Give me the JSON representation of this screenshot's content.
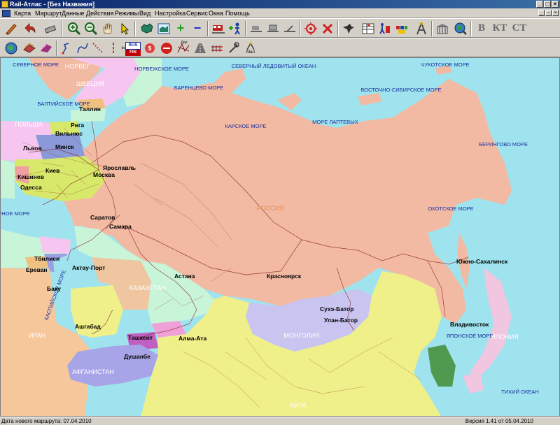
{
  "window": {
    "title": "Rail-Атлас - [Без Названия]",
    "controls": [
      "_",
      "□",
      "×"
    ]
  },
  "menu": [
    "Карта",
    "Маршрут",
    "Данные",
    "Действия",
    "Режимы",
    "Вид",
    "Настройка",
    "Сервис",
    "Окна",
    "Помощь"
  ],
  "toolbar": {
    "letters": [
      "В",
      "КТ",
      "СТ"
    ],
    "rusfin": [
      "RUS",
      "FIN"
    ],
    "small_labels": [
      "boundary",
      "Дор",
      "Мал"
    ]
  },
  "map": {
    "colors": {
      "sea": "#9fe3ee",
      "russia": "#f2b9a3",
      "kazakhstan": "#c8f4d8",
      "mongolia": "#c9c4f0",
      "china": "#f0f08a",
      "afghanistan": "#a8a4e8",
      "iran": "#f6c79a",
      "japan": "#f0c6e0",
      "ukraine": "#d8e86a",
      "belarus": "#8a9ad8",
      "poland": "#f6c6f0",
      "korea": "#4f9a4f",
      "rail": "#8a2a2a"
    },
    "seas": [
      "СЕВЕРНОЕ МОРЕ",
      "НОРВЕЖСКОЕ МОРЕ",
      "СЕВЕРНЫЙ ЛЕДОВИТЫЙ ОКЕАН",
      "ЧУКОТСКОЕ МОРЕ",
      "БАРЕНЦЕВО МОРЕ",
      "БАЛТИЙСКОЕ МОРЕ",
      "КАРСКОЕ МОРЕ",
      "МОРЕ ЛАПТЕВЫХ",
      "ВОСТОЧНО-СИБИРСКОЕ МОРЕ",
      "БЕРИНГОВО МОРЕ",
      "ОХОТСКОЕ МОРЕ",
      "ЧЕРНОЕ МОРЕ",
      "КАСПИЙСКОЕ МОРЕ",
      "ЯПОНСКОЕ МОРЕ",
      "ТИХИЙ ОКЕАН"
    ],
    "countries": [
      "НОРВЕГ",
      "ШВЕЦИЯ",
      "ПОЛЬША",
      "РОССИЯ",
      "КАЗАХСТАН",
      "МОНГОЛИЯ",
      "ИРАН",
      "АФГАНИСТАН",
      "ЯПОНИЯ",
      "КИТА"
    ],
    "cities": [
      "Таллин",
      "Рига",
      "Вильнюс",
      "Минск",
      "Львов",
      "Киев",
      "Кишинев",
      "Одесса",
      "Ярославль",
      "Москва",
      "Саратов",
      "Самара",
      "Тбилиси",
      "Ереван",
      "Баку",
      "Актау-Порт",
      "Астана",
      "Ашгабад",
      "Ташкент",
      "Душанбе",
      "Алма-Ата",
      "Красноярск",
      "Сухэ-Батор",
      "Улан-Батор",
      "Южно-Сахалинск",
      "Владивосток"
    ]
  },
  "status": {
    "route_date": "Дата нового маршрута: 07.04.2010",
    "version": "Версия 1.41 от 05.04.2010"
  }
}
